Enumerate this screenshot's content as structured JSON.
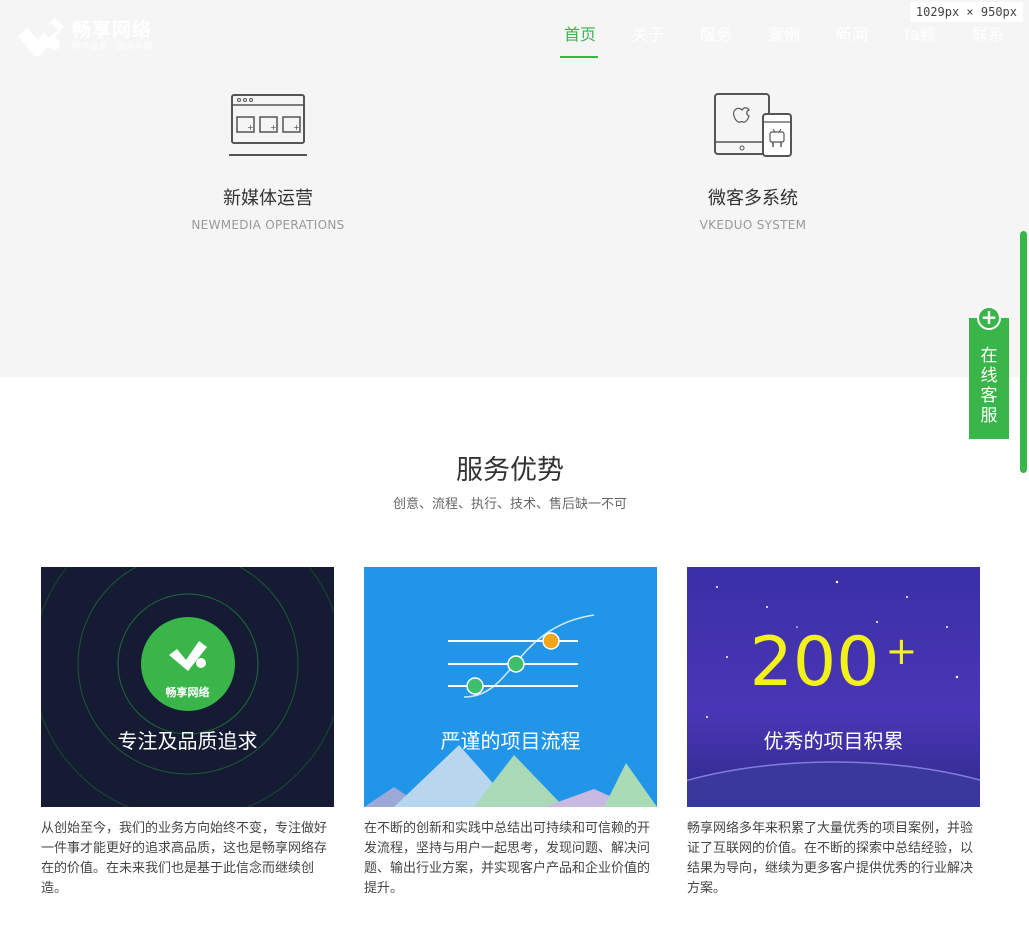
{
  "window": {
    "dimension_label": "1029px × 950px"
  },
  "brand": {
    "name": "畅享网络",
    "slogan": "畅享品质 · 追求卓越",
    "color": "#39b54a"
  },
  "nav": {
    "items": [
      {
        "label": "首页",
        "active": true
      },
      {
        "label": "关于",
        "active": false
      },
      {
        "label": "服务",
        "active": false
      },
      {
        "label": "案例",
        "active": false
      },
      {
        "label": "新闻",
        "active": false
      },
      {
        "label": "fa频",
        "active": false
      },
      {
        "label": "联系",
        "active": false
      }
    ]
  },
  "services": [
    {
      "title": "新媒体运营",
      "subtitle": "NEWMEDIA OPERATIONS",
      "icon": "browser-window-icon"
    },
    {
      "title": "微客多系统",
      "subtitle": "VKEDUO SYSTEM",
      "icon": "devices-icon"
    }
  ],
  "float_service": {
    "label": "在线客服",
    "plus": "+"
  },
  "advantages": {
    "title": "服务优势",
    "subtitle": "创意、流程、执行、技术、售后缺一不可",
    "cards": [
      {
        "caption": "专注及品质追求",
        "badge_text": "畅享网络",
        "description": "从创始至今，我们的业务方向始终不变，专注做好一件事才能更好的追求高品质，这也是畅享网络存在的价值。在未来我们也是基于此信念而继续创造。",
        "bg": "#141b33"
      },
      {
        "caption": "严谨的项目流程",
        "description": "在不断的创新和实践中总结出可持续和可信赖的开发流程，坚持与用户一起思考，发现问题、解决问题、输出行业方案，并实现客户产品和企业价值的提升。",
        "bg": "#2196e8"
      },
      {
        "caption": "优秀的项目积累",
        "count": "200",
        "count_suffix": "+",
        "description": "畅享网络多年来积累了大量优秀的项目案例，并验证了互联网的价值。在不断的探索中总结经验，以结果为导向，继续为更多客户提供优秀的行业解决方案。",
        "bg": "#3b2aa0"
      }
    ]
  }
}
